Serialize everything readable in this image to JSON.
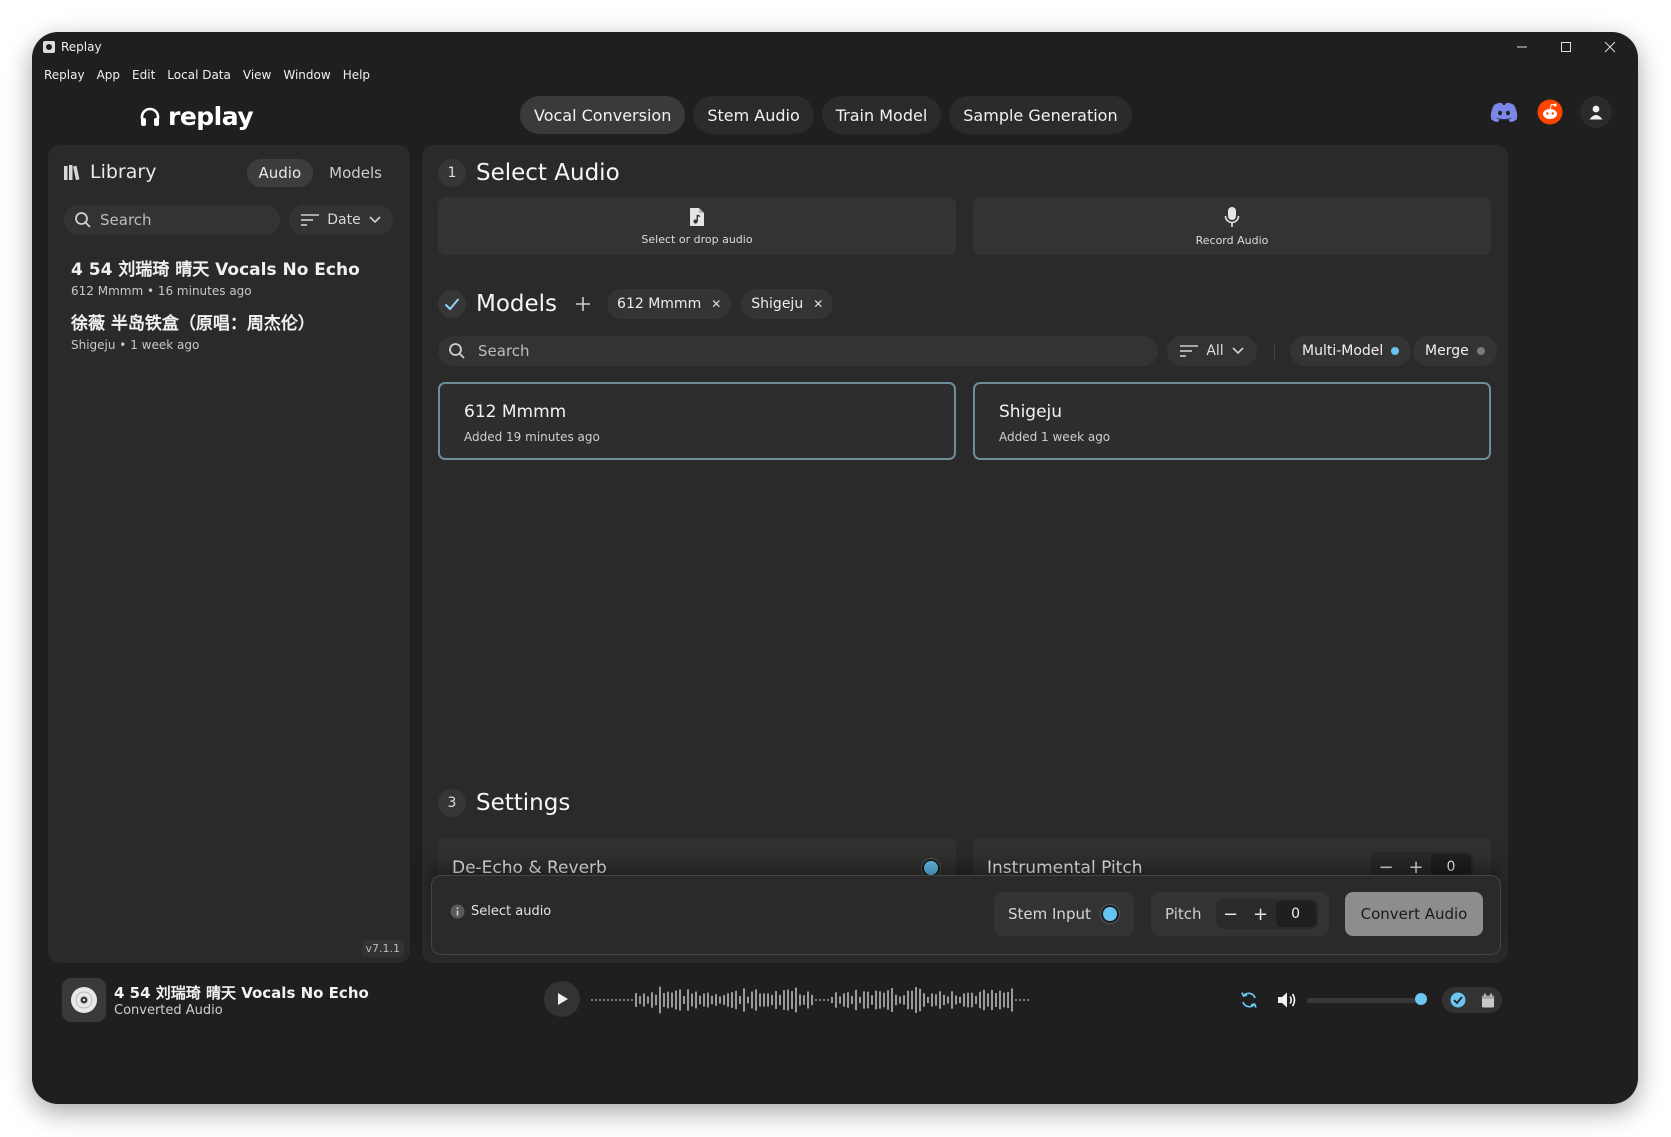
{
  "window": {
    "title": "Replay"
  },
  "menu": [
    "Replay",
    "App",
    "Edit",
    "Local Data",
    "View",
    "Window",
    "Help"
  ],
  "logo": "replay",
  "nav": {
    "tabs": [
      {
        "label": "Vocal Conversion",
        "active": true
      },
      {
        "label": "Stem Audio"
      },
      {
        "label": "Train Model"
      },
      {
        "label": "Sample Generation"
      }
    ]
  },
  "header_icons": [
    "discord-icon",
    "reddit-icon",
    "user-icon"
  ],
  "library": {
    "title": "Library",
    "tabs": [
      "Audio",
      "Models"
    ],
    "search_placeholder": "Search",
    "sort_label": "Date",
    "items": [
      {
        "name": "4 54 刘瑞琦 晴天 Vocals No Echo",
        "meta": "612 Mmmm • 16 minutes ago"
      },
      {
        "name": "徐薇 半岛铁盒（原唱：周杰伦）",
        "meta": "Shigeju • 1 week ago"
      }
    ],
    "version": "v7.1.1"
  },
  "select_audio": {
    "step": "1",
    "title": "Select Audio",
    "select_label": "Select or drop audio",
    "record_label": "Record Audio"
  },
  "models": {
    "title": "Models",
    "chips": [
      "612 Mmmm",
      "Shigeju"
    ],
    "search_placeholder": "Search",
    "filter_label": "All",
    "multi_model_label": "Multi-Model",
    "merge_label": "Merge",
    "cards": [
      {
        "name": "612 Mmmm",
        "added": "Added 19 minutes ago"
      },
      {
        "name": "Shigeju",
        "added": "Added 1 week ago"
      }
    ]
  },
  "settings": {
    "step": "3",
    "title": "Settings",
    "de_echo_label": "De-Echo & Reverb",
    "instrumental_pitch_label": "Instrumental Pitch",
    "instrumental_pitch_value": "0"
  },
  "bottom_bar": {
    "status": "Select audio",
    "stem_input_label": "Stem Input",
    "pitch_label": "Pitch",
    "pitch_value": "0",
    "convert_label": "Convert Audio"
  },
  "player": {
    "title": "4 54 刘瑞琦 晴天 Vocals No Echo",
    "subtitle": "Converted Audio",
    "volume": 0.95
  },
  "colors": {
    "accent": "#66c3f2",
    "card_border": "#6c8e99",
    "background": "#1f1f1f",
    "panel": "#2a2a2a"
  }
}
